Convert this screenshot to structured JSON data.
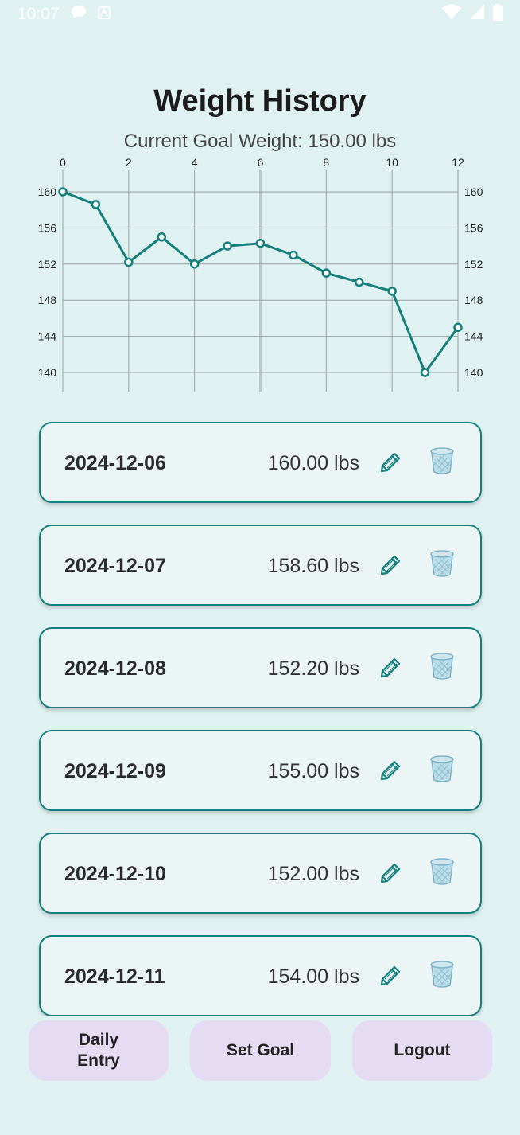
{
  "status_bar": {
    "time": "10:07",
    "left_icons": [
      "chat-bubble-icon",
      "a-notification-icon"
    ],
    "right_icons": [
      "wifi-icon",
      "cell-signal-icon",
      "battery-icon"
    ]
  },
  "header": {
    "title": "Weight History",
    "goal_text": "Current Goal Weight: 150.00 lbs"
  },
  "chart_data": {
    "type": "line",
    "x": [
      0,
      1,
      2,
      3,
      4,
      5,
      6,
      7,
      8,
      9,
      10,
      11,
      12
    ],
    "values": [
      160,
      158.6,
      152.2,
      155,
      152,
      154,
      154.3,
      153,
      151,
      150,
      149,
      140,
      145
    ],
    "xlim": [
      0,
      12
    ],
    "ylim": [
      138,
      160
    ],
    "x_ticks": [
      0,
      2,
      4,
      6,
      8,
      10,
      12
    ],
    "y_ticks": [
      140,
      144,
      148,
      152,
      156,
      160
    ],
    "grid": true,
    "line_color": "#14807d"
  },
  "entries": [
    {
      "date": "2024-12-06",
      "weight": "160.00 lbs"
    },
    {
      "date": "2024-12-07",
      "weight": "158.60 lbs"
    },
    {
      "date": "2024-12-08",
      "weight": "152.20 lbs"
    },
    {
      "date": "2024-12-09",
      "weight": "155.00 lbs"
    },
    {
      "date": "2024-12-10",
      "weight": "152.00 lbs"
    },
    {
      "date": "2024-12-11",
      "weight": "154.00 lbs"
    }
  ],
  "entry_icons": {
    "edit": "✎",
    "delete": "trash-icon"
  },
  "bottom_nav": {
    "daily_entry": "Daily\nEntry",
    "set_goal": "Set Goal",
    "logout": "Logout"
  },
  "colors": {
    "background": "#e0f1f1",
    "accent": "#14807d",
    "card_bg": "#ebf5f6",
    "button_bg": "#e5dbf3"
  }
}
